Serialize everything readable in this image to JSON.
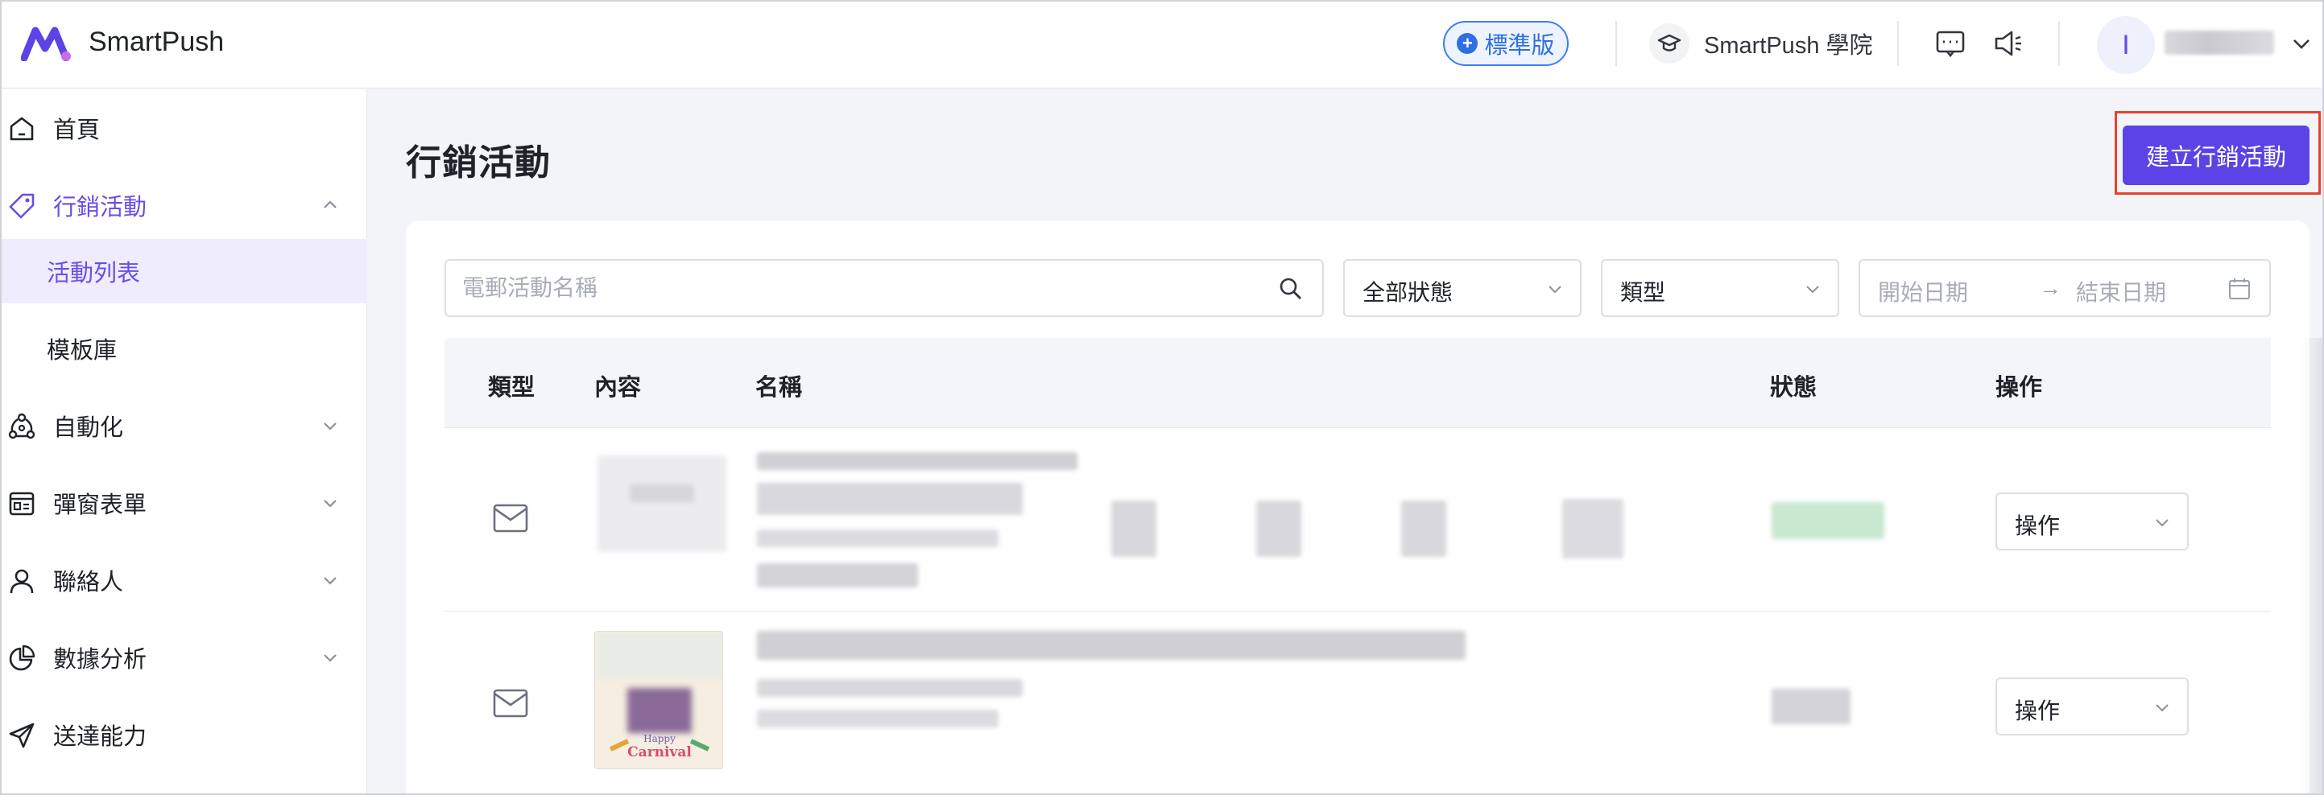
{
  "header": {
    "brand": "SmartPush",
    "plan_badge": "標準版",
    "academy": "SmartPush 學院",
    "avatar_initial": "I"
  },
  "sidebar": {
    "items": [
      {
        "label": "首頁",
        "icon": "home-icon",
        "expandable": false
      },
      {
        "label": "行銷活動",
        "icon": "tag-icon",
        "expandable": true,
        "expanded": true,
        "active": true
      },
      {
        "label": "自動化",
        "icon": "automation-icon",
        "expandable": true
      },
      {
        "label": "彈窗表單",
        "icon": "popup-form-icon",
        "expandable": true
      },
      {
        "label": "聯絡人",
        "icon": "contacts-icon",
        "expandable": true
      },
      {
        "label": "數據分析",
        "icon": "analytics-icon",
        "expandable": true
      },
      {
        "label": "送達能力",
        "icon": "send-icon",
        "expandable": false
      }
    ],
    "sub_items": [
      {
        "label": "活動列表",
        "selected": true
      },
      {
        "label": "模板庫",
        "selected": false
      }
    ]
  },
  "main": {
    "title": "行銷活動",
    "create_button": "建立行銷活動"
  },
  "filters": {
    "search_placeholder": "電郵活動名稱",
    "status_select": "全部狀態",
    "type_select": "類型",
    "start_date_placeholder": "開始日期",
    "date_arrow": "→",
    "end_date_placeholder": "結束日期"
  },
  "table": {
    "columns": [
      "類型",
      "內容",
      "名稱",
      "狀態",
      "操作"
    ],
    "rows": [
      {
        "type_icon": "mail-icon",
        "operation_label": "操作"
      },
      {
        "type_icon": "mail-icon",
        "thumbnail_text_1": "Happy",
        "thumbnail_text_2": "Carnival",
        "operation_label": "操作"
      }
    ]
  },
  "colors": {
    "accent": "#5a44e6",
    "accent_text": "#6b4de6",
    "highlight_border": "#e5432e",
    "badge_blue": "#2f6fe4"
  }
}
